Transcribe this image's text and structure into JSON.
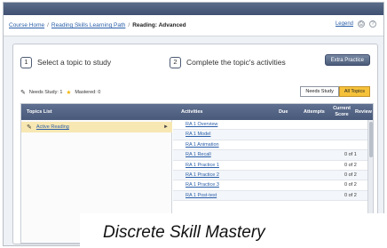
{
  "breadcrumb": {
    "items": [
      "Course Home",
      "Reading Skills Learning Path"
    ],
    "current": "Reading: Advanced",
    "right_link": "Legend"
  },
  "steps": {
    "step1_num": "1",
    "step1_label": "Select a topic to study",
    "step2_num": "2",
    "step2_label": "Complete the topic's activities",
    "extra_practice": "Extra Practice"
  },
  "status": {
    "needs_study": "Needs Study: 1",
    "mastered": "Mastered: 0"
  },
  "filters": {
    "needs_study": "Needs Study",
    "all_topics": "All Topics"
  },
  "table": {
    "headers": {
      "topics": "Topics List",
      "activities": "Activities",
      "due": "Due",
      "attempts": "Attempts",
      "score_line1": "Current",
      "score_line2": "Score",
      "review": "Review"
    },
    "topic": "Active Reading",
    "activities": [
      {
        "name": "RA 1 Overview",
        "attempts": "",
        "score": ""
      },
      {
        "name": "RA 1 Model",
        "attempts": "",
        "score": ""
      },
      {
        "name": "RA 1 Animation",
        "attempts": "",
        "score": ""
      },
      {
        "name": "RA 1 Recall",
        "attempts": "",
        "score": "0 of 1"
      },
      {
        "name": "RA 1 Practice 1",
        "attempts": "",
        "score": "0 of 2"
      },
      {
        "name": "RA 1 Practice 2",
        "attempts": "",
        "score": "0 of 2"
      },
      {
        "name": "RA 1 Practice 3",
        "attempts": "",
        "score": "0 of 2"
      },
      {
        "name": "RA 1 Post-test",
        "attempts": "",
        "score": "0 of 2"
      }
    ]
  },
  "caption": "Discrete Skill Mastery"
}
